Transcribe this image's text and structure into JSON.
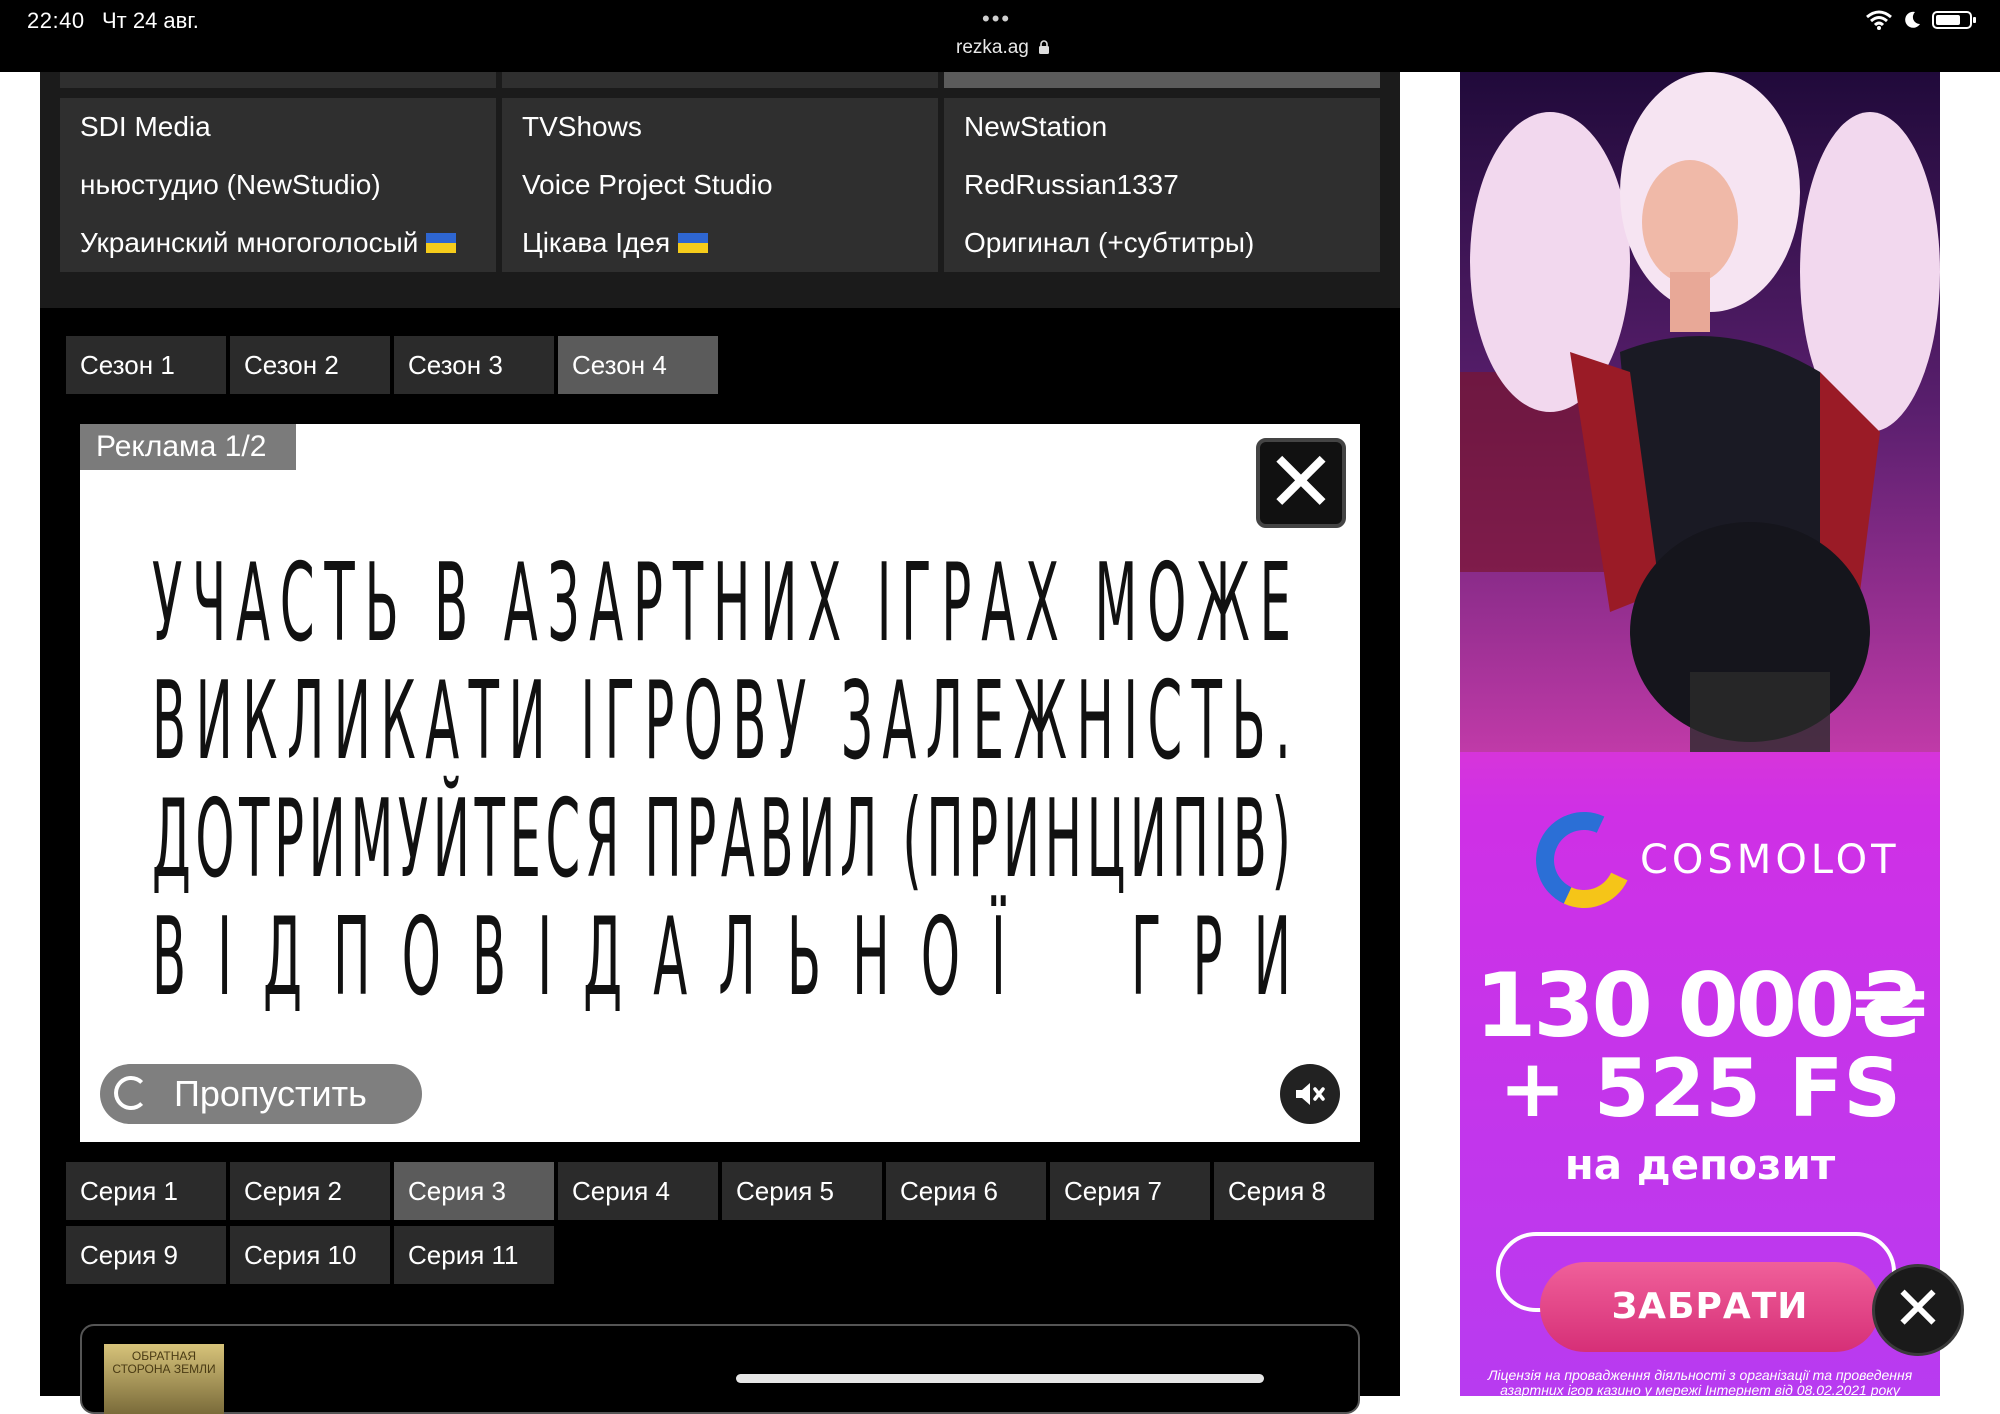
{
  "status_bar": {
    "time": "22:40",
    "date": "Чт 24 авг.",
    "dots": "•••",
    "url": "rezka.ag",
    "icons": [
      "wifi-icon",
      "moon-icon",
      "battery-icon"
    ]
  },
  "translators": [
    {
      "label": "SDI Media",
      "flag": false
    },
    {
      "label": "TVShows",
      "flag": false
    },
    {
      "label": "NewStation",
      "flag": false
    },
    {
      "label": "ньюстудио (NewStudio)",
      "flag": false
    },
    {
      "label": "Voice Project Studio",
      "flag": false
    },
    {
      "label": "RedRussian1337",
      "flag": false
    },
    {
      "label": "Украинский многоголосый",
      "flag": true
    },
    {
      "label": "Цікава Ідея",
      "flag": true
    },
    {
      "label": "Оригинал (+субтитры)",
      "flag": false
    }
  ],
  "seasons": [
    {
      "label": "Сезон 1",
      "active": false
    },
    {
      "label": "Сезон 2",
      "active": false
    },
    {
      "label": "Сезон 3",
      "active": false
    },
    {
      "label": "Сезон 4",
      "active": true
    }
  ],
  "ad": {
    "label": "Реклама 1/2",
    "close_glyph": "✕",
    "lines": [
      [
        "У",
        "Ч",
        "А",
        "С",
        "Т",
        "Ь",
        " ",
        "В",
        " ",
        "А",
        "З",
        "А",
        "Р",
        "Т",
        "Н",
        "И",
        "Х",
        " ",
        "І",
        "Г",
        "Р",
        "А",
        "Х",
        " ",
        "М",
        "О",
        "Ж",
        "Е"
      ],
      [
        "В",
        "И",
        "К",
        "Л",
        "И",
        "К",
        "А",
        "Т",
        "И",
        " ",
        "І",
        "Г",
        "Р",
        "О",
        "В",
        "У",
        " ",
        "З",
        "А",
        "Л",
        "Е",
        "Ж",
        "Н",
        "І",
        "С",
        "Т",
        "Ь",
        "."
      ],
      [
        "Д",
        "О",
        "Т",
        "Р",
        "И",
        "М",
        "У",
        "Й",
        "Т",
        "Е",
        "С",
        "Я",
        " ",
        "П",
        "Р",
        "А",
        "В",
        "И",
        "Л",
        " ",
        "(",
        "П",
        "Р",
        "И",
        "Н",
        "Ц",
        "И",
        "П",
        "І",
        "В",
        ")"
      ],
      [
        "В",
        "І",
        "Д",
        "П",
        "О",
        "В",
        "І",
        "Д",
        "А",
        "Л",
        "Ь",
        "Н",
        "О",
        "Ї",
        " ",
        " ",
        "Г",
        "Р",
        "И"
      ]
    ],
    "skip_label": "Пропустить"
  },
  "episodes": [
    {
      "label": "Серия 1",
      "active": false
    },
    {
      "label": "Серия 2",
      "active": false
    },
    {
      "label": "Серия 3",
      "active": true
    },
    {
      "label": "Серия 4",
      "active": false
    },
    {
      "label": "Серия 5",
      "active": false
    },
    {
      "label": "Серия 6",
      "active": false
    },
    {
      "label": "Серия 7",
      "active": false
    },
    {
      "label": "Серия 8",
      "active": false
    },
    {
      "label": "Серия 9",
      "active": false
    },
    {
      "label": "Серия 10",
      "active": false
    },
    {
      "label": "Серия 11",
      "active": false
    }
  ],
  "card": {
    "thumb_text": "ОБРАТНАЯ СТОРОНА ЗЕМЛИ"
  },
  "banner": {
    "brand": "COSMOLOT",
    "bonus_amount": "130 000₴",
    "bonus_fs": "+ 525 FS",
    "bonus_note": "на депозит",
    "cta": "ЗАБРАТИ",
    "license": "Ліцензія на провадження діяльності з організації та проведення азартних ігор казино у мережі Інтернет від 08.02.2021 року",
    "close_glyph": "✕",
    "colors": {
      "ring_blue": "#2b6fd6",
      "ring_yellow": "#f5c518",
      "cta_pink": "#e0437f",
      "background_magenta": "#d23be6"
    }
  }
}
